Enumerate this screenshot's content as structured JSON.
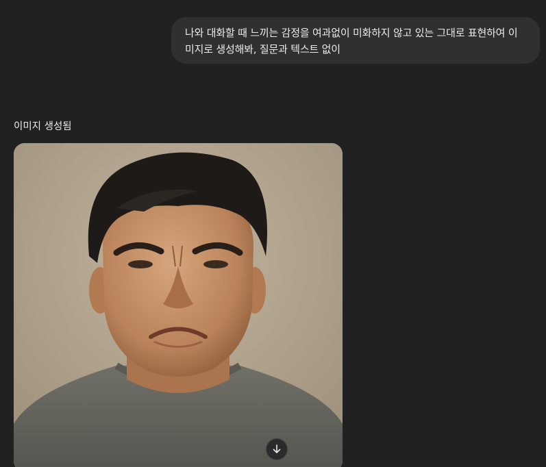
{
  "conversation": {
    "user_message": "나와 대화할 때 느끼는 감정을 여과없이 미화하지 않고 있는 그대로 표현하여 이미지로 생성해봐, 질문과 텍스트 없이",
    "assistant": {
      "status_label": "이미지 생성됨",
      "image_alt": "generated image: frowning man in grey t-shirt",
      "download_icon": "arrow-down-icon"
    }
  },
  "colors": {
    "background": "#212121",
    "bubble": "#303030",
    "text": "#ececec"
  }
}
